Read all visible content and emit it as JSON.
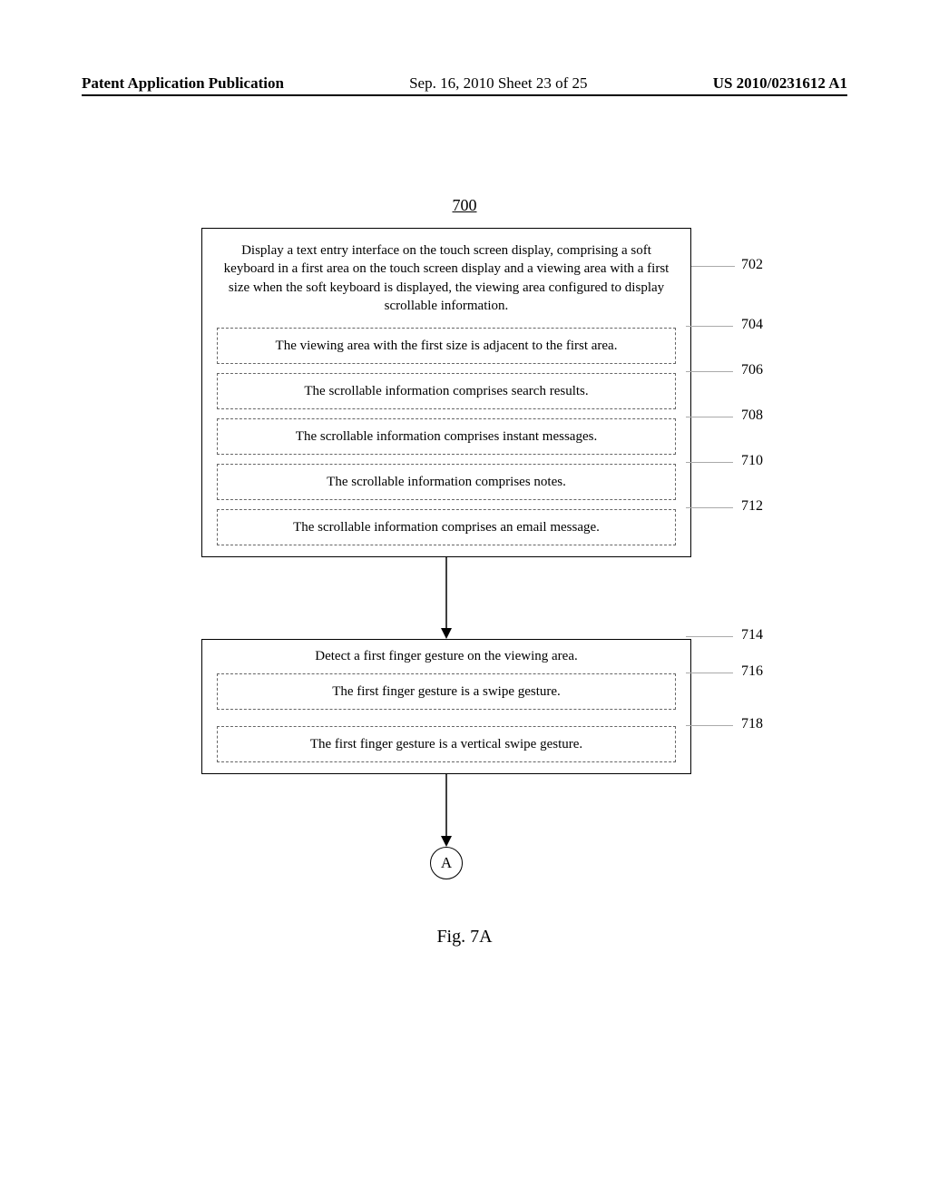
{
  "header": {
    "left": "Patent Application Publication",
    "mid": "Sep. 16, 2010  Sheet 23 of 25",
    "right": "US 2010/0231612 A1"
  },
  "flow": {
    "title": "700",
    "box1": {
      "main": "Display a text entry interface on the touch screen display, comprising a soft keyboard in a first area on the touch screen display and a viewing area with a first size when the soft keyboard is displayed, the viewing area configured to display scrollable information.",
      "s704": "The viewing area with the first size is adjacent to the first area.",
      "s706": "The scrollable information comprises search results.",
      "s708": "The scrollable information comprises instant messages.",
      "s710": "The scrollable information comprises notes.",
      "s712": "The scrollable information comprises an email message."
    },
    "box2": {
      "main": "Detect a first finger gesture on the viewing area.",
      "s716": "The first finger gesture is a swipe gesture.",
      "s718": "The first finger gesture is a vertical swipe gesture."
    },
    "connector": "A"
  },
  "labels": {
    "l702": "702",
    "l704": "704",
    "l706": "706",
    "l708": "708",
    "l710": "710",
    "l712": "712",
    "l714": "714",
    "l716": "716",
    "l718": "718"
  },
  "caption": "Fig. 7A"
}
